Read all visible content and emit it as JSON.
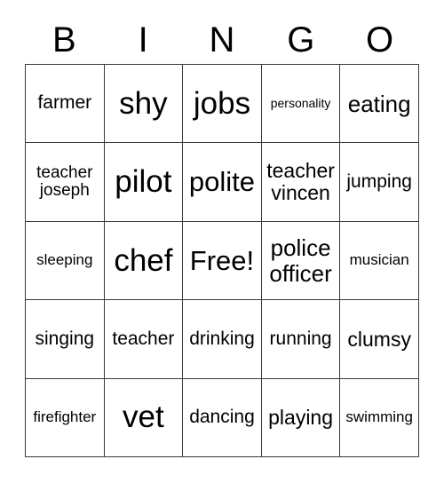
{
  "card": {
    "title": "BINGO card",
    "header_letters": [
      "B",
      "I",
      "N",
      "G",
      "O"
    ],
    "free_space_label": "Free!",
    "colors": {
      "border": "#3a3a3a",
      "text": "#000000",
      "background": "#ffffff"
    },
    "rows": [
      [
        {
          "text": "farmer",
          "size": "fs-m"
        },
        {
          "text": "shy",
          "size": "fs-xxl"
        },
        {
          "text": "jobs",
          "size": "fs-xxl"
        },
        {
          "text": "personality",
          "size": "fs-xs"
        },
        {
          "text": "eating",
          "size": "fs-l"
        }
      ],
      [
        {
          "text": "teacher\njoseph",
          "size": "fs-sm"
        },
        {
          "text": "pilot",
          "size": "fs-xxl"
        },
        {
          "text": "polite",
          "size": "fs-xl"
        },
        {
          "text": "teacher\nvincen",
          "size": "fs-ml"
        },
        {
          "text": "jumping",
          "size": "fs-m"
        }
      ],
      [
        {
          "text": "sleeping",
          "size": "fs-s"
        },
        {
          "text": "chef",
          "size": "fs-xxl"
        },
        {
          "text": "Free!",
          "size": "fs-xl"
        },
        {
          "text": "police\nofficer",
          "size": "fs-l"
        },
        {
          "text": "musician",
          "size": "fs-s"
        }
      ],
      [
        {
          "text": "singing",
          "size": "fs-m"
        },
        {
          "text": "teacher",
          "size": "fs-m"
        },
        {
          "text": "drinking",
          "size": "fs-m"
        },
        {
          "text": "running",
          "size": "fs-m"
        },
        {
          "text": "clumsy",
          "size": "fs-ml"
        }
      ],
      [
        {
          "text": "firefighter",
          "size": "fs-s"
        },
        {
          "text": "vet",
          "size": "fs-xxl"
        },
        {
          "text": "dancing",
          "size": "fs-m"
        },
        {
          "text": "playing",
          "size": "fs-ml"
        },
        {
          "text": "swimming",
          "size": "fs-s"
        }
      ]
    ]
  }
}
